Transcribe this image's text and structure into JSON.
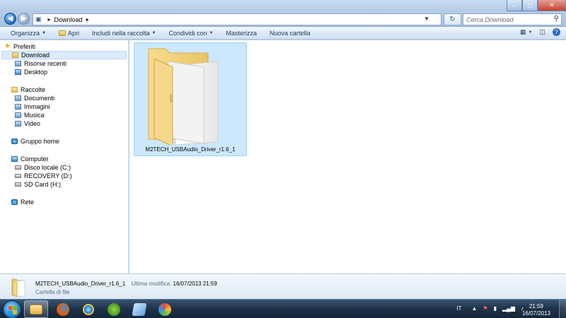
{
  "address": {
    "path": [
      "Download"
    ],
    "search_placeholder": "Cerca Download"
  },
  "toolbar": {
    "organize": "Organizza",
    "open": "Apri",
    "include": "Includi nella raccolta",
    "share": "Condividi con",
    "burn": "Masterizza",
    "new_folder": "Nuova cartella"
  },
  "sidebar": {
    "favorites": "Preferiti",
    "favorites_items": [
      "Download",
      "Risorse recenti",
      "Desktop"
    ],
    "libraries": "Raccolte",
    "libraries_items": [
      "Documenti",
      "Immagini",
      "Musica",
      "Video"
    ],
    "homegroup": "Gruppo home",
    "computer": "Computer",
    "computer_items": [
      "Disco locale (C:)",
      "RECOVERY (D:)",
      "SD Card (H:)"
    ],
    "network": "Rete"
  },
  "content": {
    "items": [
      {
        "name": "M2TECH_USBAudio_Driver_r1.6_1",
        "icon": "folder-icon"
      }
    ]
  },
  "details": {
    "name": "M2TECH_USBAudio_Driver_r1.6_1",
    "modified_label": "Ultima modifica:",
    "modified_value": "16/07/2013 21:59",
    "type": "Cartella di file"
  },
  "taskbar": {
    "language": "IT",
    "time": "21:59",
    "date": "16/07/2013"
  }
}
